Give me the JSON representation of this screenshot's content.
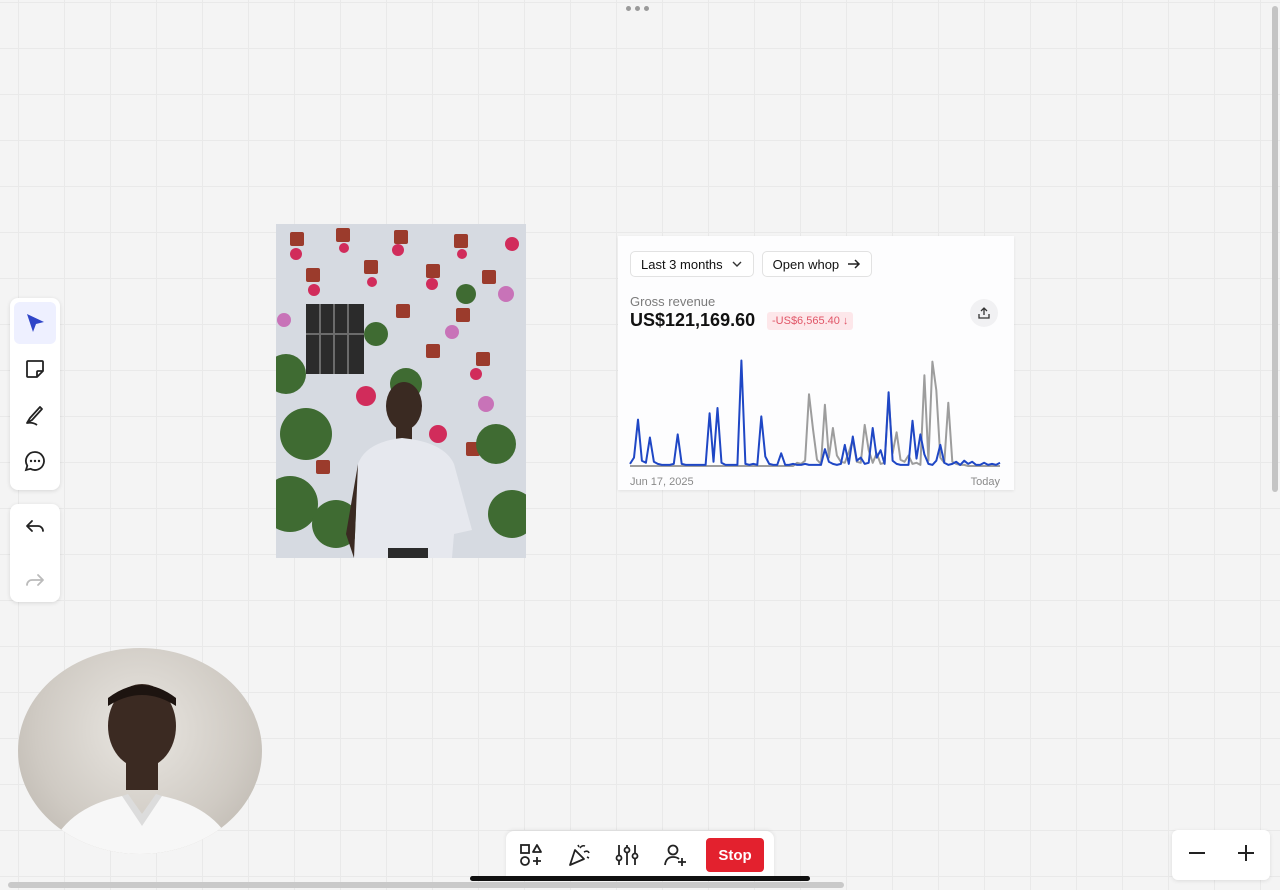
{
  "toolbar": {
    "tools": [
      "select-tool",
      "sticky-note-tool",
      "pen-tool",
      "comment-tool"
    ],
    "history": [
      "undo",
      "redo"
    ]
  },
  "revenue_card": {
    "period_label": "Last 3 months",
    "open_label": "Open whop",
    "metric_label": "Gross revenue",
    "metric_value": "US$121,169.60",
    "change_label": "-US$6,565.40 ↓",
    "start_date": "Jun 17, 2025",
    "end_date": "Today"
  },
  "bottom_toolbar": {
    "stop_label": "Stop"
  },
  "colors": {
    "accent": "#2f45c8",
    "stop": "#e3212e",
    "negative": "#e05567",
    "current_series": "#1f47c5",
    "previous_series": "#9d9d9d"
  },
  "chart_data": {
    "type": "line",
    "x": [
      0,
      1,
      2,
      3,
      4,
      5,
      6,
      7,
      8,
      9,
      10,
      11,
      12,
      13,
      14,
      15,
      16,
      17,
      18,
      19,
      20,
      21,
      22,
      23,
      24,
      25,
      26,
      27,
      28,
      29,
      30,
      31,
      32,
      33,
      34,
      35,
      36,
      37,
      38,
      39,
      40,
      41,
      42,
      43,
      44,
      45,
      46,
      47,
      48,
      49,
      50,
      51,
      52,
      53,
      54,
      55,
      56,
      57,
      58,
      59,
      60,
      61,
      62,
      63,
      64,
      65,
      66,
      67,
      68,
      69,
      70,
      71,
      72,
      73,
      74,
      75,
      76,
      77,
      78,
      79,
      80,
      81,
      82,
      83,
      84,
      85,
      86,
      87,
      88,
      89,
      90,
      91,
      92,
      93
    ],
    "series": [
      {
        "values": [
          0.2,
          0.8,
          4.4,
          0.5,
          0.3,
          2.7,
          0.4,
          0.2,
          0.1,
          0.1,
          0.1,
          0.2,
          3.0,
          0.2,
          0.1,
          0.1,
          0.1,
          0.1,
          0.1,
          0.1,
          5.0,
          0.4,
          5.5,
          0.3,
          0.1,
          0.1,
          0.1,
          0.1,
          10.0,
          0.2,
          0.1,
          0.2,
          0.1,
          4.7,
          0.9,
          0.2,
          0.1,
          0.1,
          1.2,
          0.1,
          0.1,
          0.2,
          0.1,
          0.1,
          0.2,
          0.1,
          0.1,
          0.1,
          0.1,
          1.6,
          0.4,
          0.2,
          0.1,
          0.2,
          2.0,
          0.2,
          2.8,
          0.5,
          0.8,
          0.2,
          0.3,
          3.6,
          0.8,
          1.5,
          0.2,
          7.0,
          0.5,
          0.2,
          0.1,
          0.1,
          0.1,
          4.3,
          0.7,
          3.0,
          1.1,
          0.2,
          0.1,
          0.5,
          2.0,
          0.3,
          0.1,
          0.2,
          0.4,
          0.1,
          0.5,
          0.2,
          0.4,
          0.1,
          0.1,
          0.3,
          0.1,
          0.2,
          0.1,
          0.3
        ]
      },
      {
        "values": [
          0,
          0,
          0,
          0,
          0,
          0,
          0,
          0,
          0,
          0,
          0,
          0,
          0,
          0,
          0,
          0,
          0,
          0,
          0,
          0,
          0,
          0,
          0,
          0,
          0,
          0,
          0,
          0,
          0,
          0,
          0,
          0,
          0,
          0,
          0,
          0,
          0,
          0,
          0,
          0,
          0,
          0,
          0.3,
          0.2,
          0.5,
          6.8,
          3.5,
          0.6,
          0.2,
          5.8,
          0.8,
          3.6,
          1.0,
          0.4,
          0.3,
          1.3,
          2.5,
          0.4,
          0.3,
          3.9,
          1.5,
          0.3,
          1.2,
          0.2,
          0.3,
          6.5,
          1.2,
          3.2,
          0.6,
          0.4,
          1.0,
          0.2,
          0.3,
          0.1,
          8.6,
          0.5,
          9.9,
          7.2,
          0.8,
          0.3,
          6.0,
          0.4,
          0.2,
          0.1,
          0.1,
          0,
          0,
          0,
          0,
          0,
          0,
          0,
          0,
          0
        ]
      }
    ],
    "xlabel": "",
    "ylabel": "",
    "tick_labels": [
      "Jun 17, 2025",
      "Today"
    ]
  }
}
